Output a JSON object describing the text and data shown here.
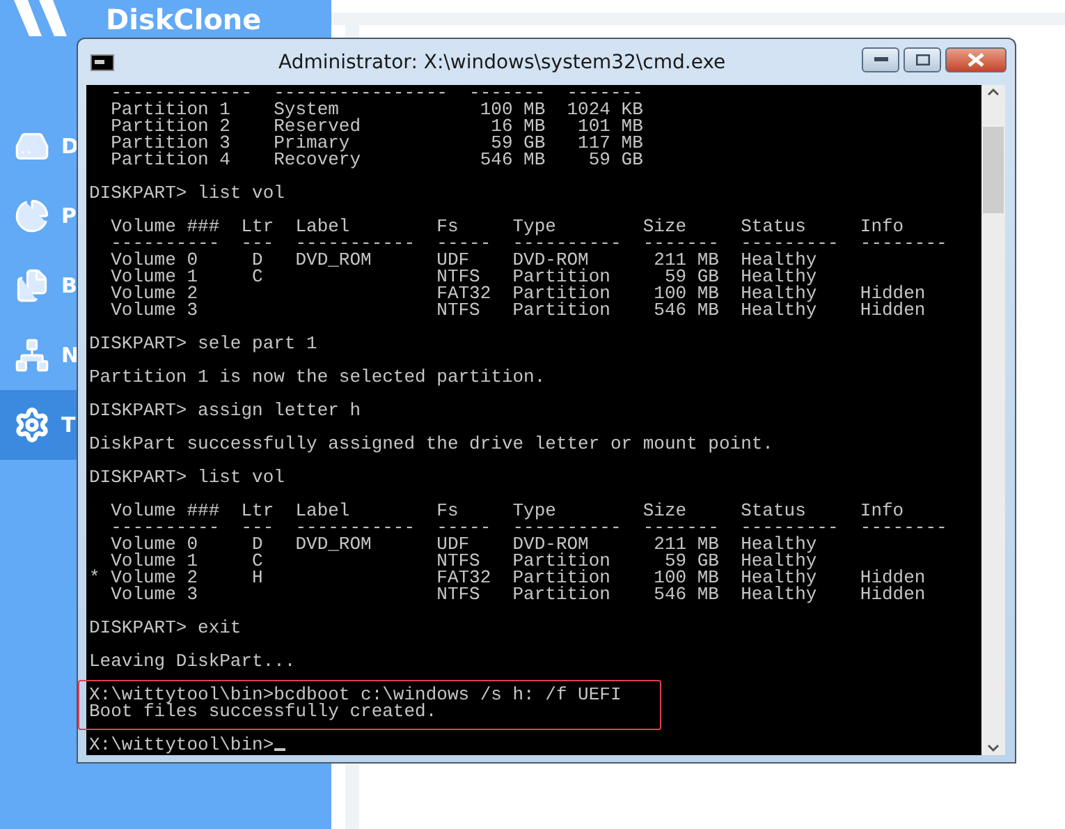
{
  "sidebar": {
    "app_name": "DiskClone",
    "items": [
      {
        "kind": "drive",
        "label": "D",
        "selected": false
      },
      {
        "kind": "chart",
        "label": "P",
        "selected": false
      },
      {
        "kind": "document",
        "label": "B",
        "selected": false
      },
      {
        "kind": "network",
        "label": "N",
        "selected": false
      },
      {
        "kind": "settings",
        "label": "T",
        "selected": true
      }
    ]
  },
  "console_window": {
    "title": "Administrator: X:\\windows\\system32\\cmd.exe",
    "blocks": [
      {
        "highlighted": false,
        "lines": [
          "  -------------  ----------------  -------  -------",
          "  Partition 1    System             100 MB  1024 KB",
          "  Partition 2    Reserved            16 MB   101 MB",
          "  Partition 3    Primary             59 GB   117 MB",
          "  Partition 4    Recovery           546 MB    59 GB"
        ]
      },
      {
        "highlighted": false,
        "lines": [
          "DISKPART> list vol"
        ]
      },
      {
        "highlighted": false,
        "lines": [
          "  Volume ###  Ltr  Label        Fs     Type        Size     Status     Info",
          "  ----------  ---  -----------  -----  ----------  -------  ---------  --------",
          "  Volume 0     D   DVD_ROM      UDF    DVD-ROM      211 MB  Healthy",
          "  Volume 1     C                NTFS   Partition     59 GB  Healthy",
          "  Volume 2                      FAT32  Partition    100 MB  Healthy    Hidden",
          "  Volume 3                      NTFS   Partition    546 MB  Healthy    Hidden"
        ]
      },
      {
        "highlighted": false,
        "lines": [
          "DISKPART> sele part 1"
        ]
      },
      {
        "highlighted": false,
        "lines": [
          "Partition 1 is now the selected partition."
        ]
      },
      {
        "highlighted": false,
        "lines": [
          "DISKPART> assign letter h"
        ]
      },
      {
        "highlighted": false,
        "lines": [
          "DiskPart successfully assigned the drive letter or mount point."
        ]
      },
      {
        "highlighted": false,
        "lines": [
          "DISKPART> list vol"
        ]
      },
      {
        "highlighted": false,
        "lines": [
          "  Volume ###  Ltr  Label        Fs     Type        Size     Status     Info",
          "  ----------  ---  -----------  -----  ----------  -------  ---------  --------",
          "  Volume 0     D   DVD_ROM      UDF    DVD-ROM      211 MB  Healthy",
          "  Volume 1     C                NTFS   Partition     59 GB  Healthy",
          "* Volume 2     H                FAT32  Partition    100 MB  Healthy    Hidden",
          "  Volume 3                      NTFS   Partition    546 MB  Healthy    Hidden"
        ]
      },
      {
        "highlighted": false,
        "lines": [
          "DISKPART> exit"
        ]
      },
      {
        "highlighted": false,
        "lines": [
          "Leaving DiskPart..."
        ]
      },
      {
        "highlighted": true,
        "lines": [
          "X:\\wittytool\\bin>bcdboot c:\\windows /s h: /f UEFI",
          "Boot files successfully created."
        ]
      },
      {
        "highlighted": false,
        "cursor": true,
        "lines": [
          "X:\\wittytool\\bin>"
        ]
      }
    ]
  }
}
